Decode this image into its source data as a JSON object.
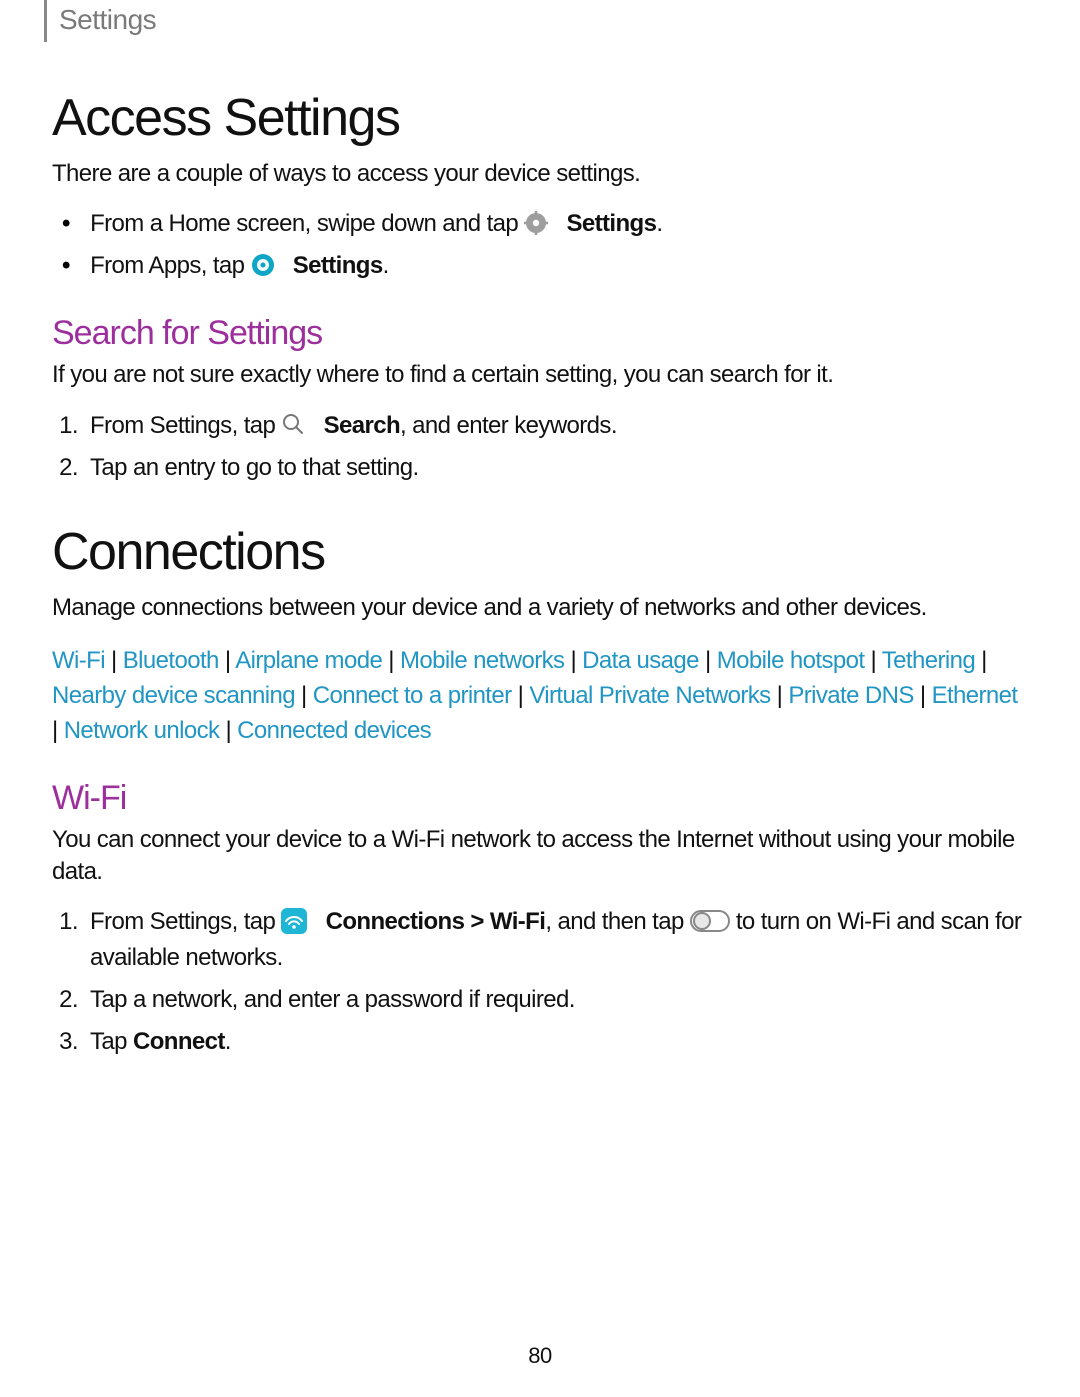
{
  "header": {
    "tab": "Settings"
  },
  "s1": {
    "title": "Access Settings",
    "intro": "There are a couple of ways to access your device settings.",
    "bullet1": {
      "pre": "From a Home screen, swipe down and tap ",
      "bold": "Settings",
      "post": "."
    },
    "bullet2": {
      "pre": "From Apps, tap ",
      "bold": "Settings",
      "post": "."
    }
  },
  "s2": {
    "title": "Search for Settings",
    "intro": "If you are not sure exactly where to find a certain setting, you can search for it.",
    "step1": {
      "pre": "From Settings, tap ",
      "bold": "Search",
      "post": ", and enter keywords."
    },
    "step2": "Tap an entry to go to that setting."
  },
  "s3": {
    "title": "Connections",
    "intro": "Manage connections between your device and a variety of networks and other devices.",
    "links": [
      "Wi-Fi",
      "Bluetooth",
      "Airplane mode",
      "Mobile networks",
      "Data usage",
      "Mobile hotspot",
      "Tethering",
      "Nearby device scanning",
      "Connect to a printer",
      "Virtual Private Networks",
      "Private DNS",
      "Ethernet",
      "Network unlock",
      "Connected devices"
    ]
  },
  "s4": {
    "title": "Wi-Fi",
    "intro": "You can connect your device to a Wi-Fi network to access the Internet without using your mobile data.",
    "step1": {
      "pre": "From Settings, tap ",
      "bold": "Connections > Wi-Fi",
      "mid": ", and then tap ",
      "post": " to turn on Wi-Fi and scan for available networks."
    },
    "step2": "Tap a network, and enter a password if required.",
    "step3": {
      "pre": "Tap ",
      "bold": "Connect",
      "post": "."
    }
  },
  "page_number": "80"
}
